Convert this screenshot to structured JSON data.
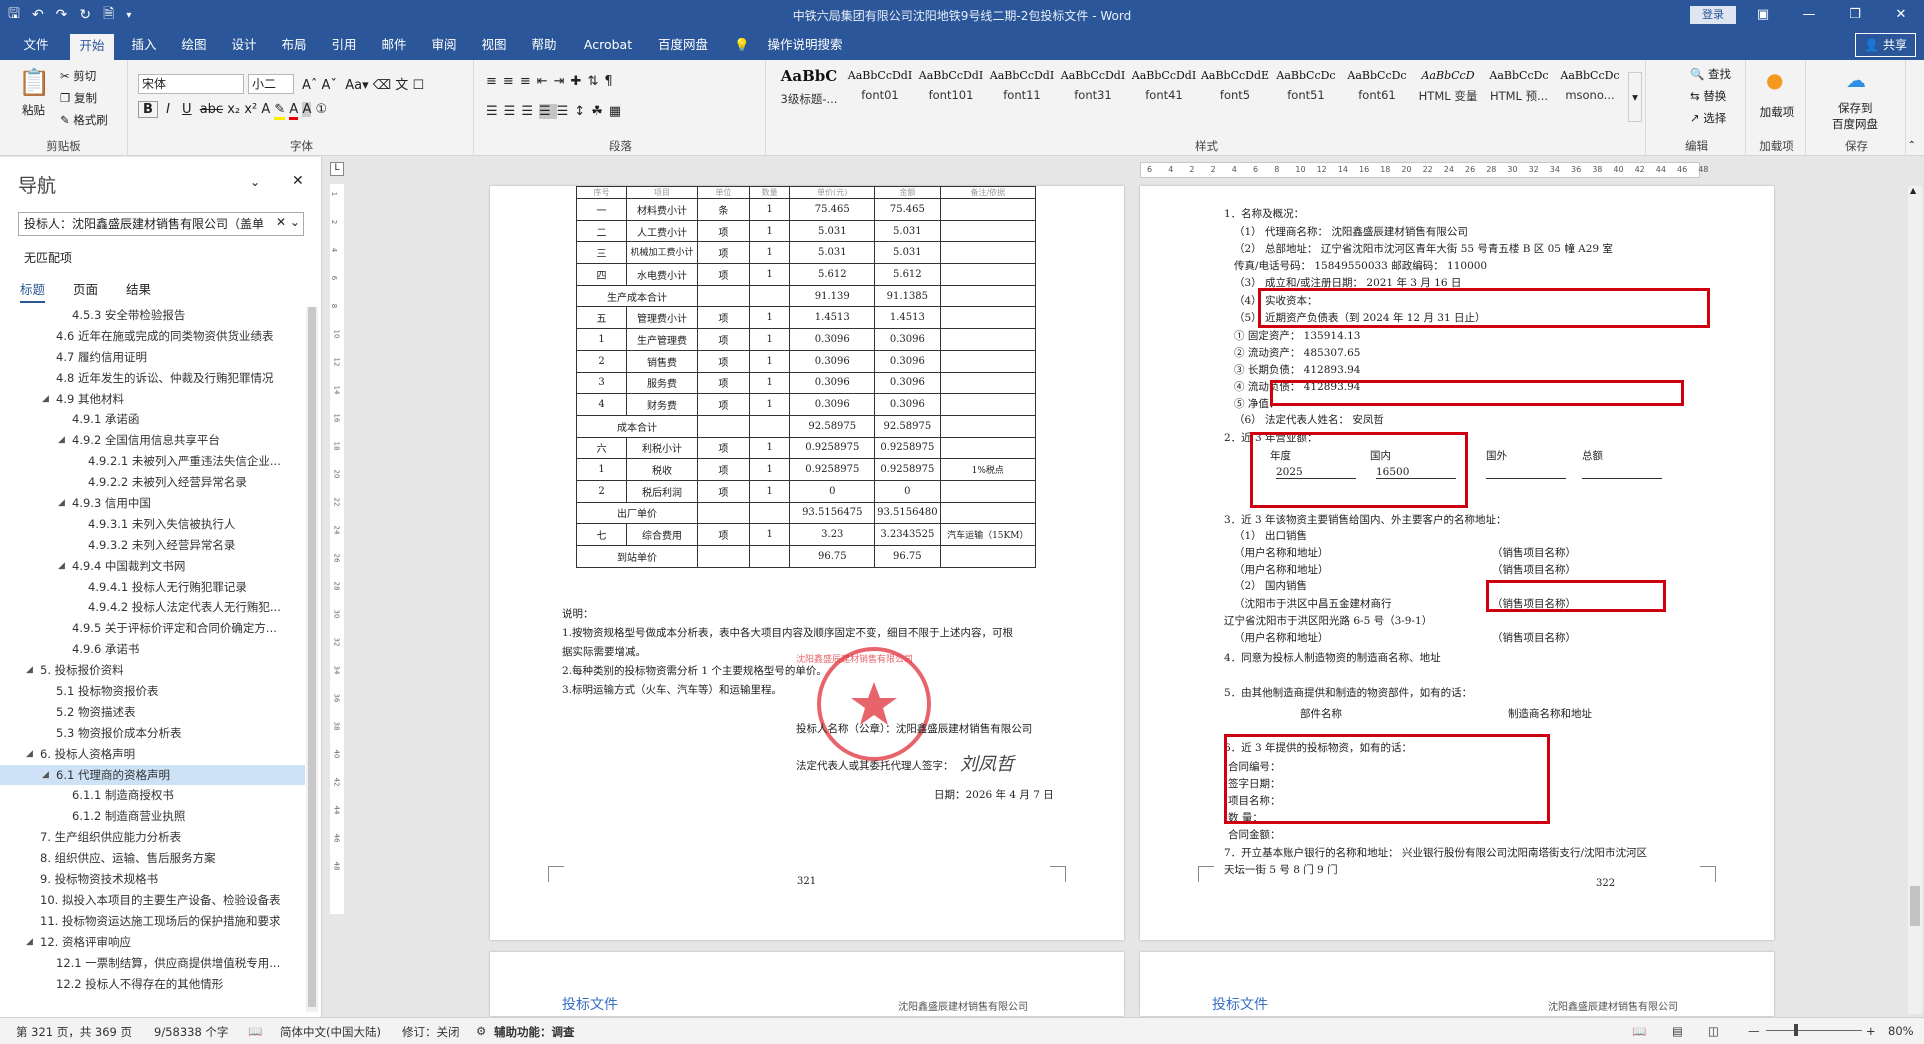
{
  "title_bar": {
    "document_title": "中铁六局集团有限公司沈阳地铁9号线二期-2包投标文件  -  Word",
    "login": "登录",
    "qat_icons": [
      "save-icon",
      "undo-icon",
      "redo-icon",
      "autosave-icon",
      "doc-icon",
      "customize-icon"
    ]
  },
  "tabs": [
    "文件",
    "开始",
    "插入",
    "绘图",
    "设计",
    "布局",
    "引用",
    "邮件",
    "审阅",
    "视图",
    "帮助",
    "Acrobat",
    "百度网盘",
    "操作说明搜索"
  ],
  "active_tab": "开始",
  "share": "共享",
  "ribbon": {
    "clipboard": {
      "paste": "粘贴",
      "cut": "剪切",
      "copy": "复制",
      "format_painter": "格式刷",
      "group": "剪贴板"
    },
    "font": {
      "name": "宋体",
      "size": "小二",
      "group": "字体"
    },
    "paragraph": {
      "group": "段落"
    },
    "styles": {
      "group": "样式",
      "items": [
        {
          "sample": "AaBbC",
          "name": "3级标题-..."
        },
        {
          "sample": "AaBbCcDdI",
          "name": "font01"
        },
        {
          "sample": "AaBbCcDdI",
          "name": "font101"
        },
        {
          "sample": "AaBbCcDdI",
          "name": "font11"
        },
        {
          "sample": "AaBbCcDdI",
          "name": "font31"
        },
        {
          "sample": "AaBbCcDdI",
          "name": "font41"
        },
        {
          "sample": "AaBbCcDdE",
          "name": "font5"
        },
        {
          "sample": "AaBbCcDc",
          "name": "font51"
        },
        {
          "sample": "AaBbCcDc",
          "name": "font61"
        },
        {
          "sample": "AaBbCcD",
          "name": "HTML 变量"
        },
        {
          "sample": "AaBbCcDc",
          "name": "HTML 预..."
        },
        {
          "sample": "AaBbCcDc",
          "name": "msono..."
        }
      ]
    },
    "editing": {
      "find": "查找",
      "replace": "替换",
      "select": "选择",
      "group": "编辑"
    },
    "addins": {
      "label": "加载项",
      "group": "加载项"
    },
    "save": {
      "label1": "保存到",
      "label2": "百度网盘",
      "group": "保存"
    }
  },
  "nav": {
    "title": "导航",
    "search": "投标人：沈阳鑫盛辰建材销售有限公司（盖单",
    "no_match": "无匹配项",
    "subtabs": [
      "标题",
      "页面",
      "结果"
    ],
    "items": [
      {
        "text": "4.5.3 安全带检验报告",
        "level": 4
      },
      {
        "text": "4.6 近年在施或完成的同类物资供货业绩表",
        "level": 3
      },
      {
        "text": "4.7 履约信用证明",
        "level": 3
      },
      {
        "text": "4.8 近年发生的诉讼、仲裁及行贿犯罪情况",
        "level": 3
      },
      {
        "text": "4.9 其他材料",
        "level": 3,
        "expand": true
      },
      {
        "text": "4.9.1 承诺函",
        "level": 4
      },
      {
        "text": "4.9.2 全国信用信息共享平台",
        "level": 4,
        "expand": true
      },
      {
        "text": "4.9.2.1 未被列入严重违法失信企业...",
        "level": 5
      },
      {
        "text": "4.9.2.2 未被列入经营异常名录",
        "level": 5
      },
      {
        "text": "4.9.3 信用中国",
        "level": 4,
        "expand": true
      },
      {
        "text": "4.9.3.1 未列入失信被执行人",
        "level": 5
      },
      {
        "text": "4.9.3.2 未列入经营异常名录",
        "level": 5
      },
      {
        "text": "4.9.4 中国裁判文书网",
        "level": 4,
        "expand": true
      },
      {
        "text": "4.9.4.1 投标人无行贿犯罪记录",
        "level": 5
      },
      {
        "text": "4.9.4.2 投标人法定代表人无行贿犯...",
        "level": 5
      },
      {
        "text": "4.9.5 关于评标价评定和合同价确定方...",
        "level": 4
      },
      {
        "text": "4.9.6 承诺书",
        "level": 4
      },
      {
        "text": "5. 投标报价资料",
        "level": 2,
        "expand": true
      },
      {
        "text": "5.1 投标物资报价表",
        "level": 3
      },
      {
        "text": "5.2 物资描述表",
        "level": 3
      },
      {
        "text": "5.3 物资报价成本分析表",
        "level": 3
      },
      {
        "text": "6. 投标人资格声明",
        "level": 2,
        "expand": true
      },
      {
        "text": "6.1 代理商的资格声明",
        "level": 3,
        "expand": true,
        "selected": true
      },
      {
        "text": "6.1.1 制造商授权书",
        "level": 4
      },
      {
        "text": "6.1.2 制造商营业执照",
        "level": 4
      },
      {
        "text": "7. 生产组织供应能力分析表",
        "level": 2
      },
      {
        "text": "8. 组织供应、运输、售后服务方案",
        "level": 2
      },
      {
        "text": "9. 投标物资技术规格书",
        "level": 2
      },
      {
        "text": "10. 拟投入本项目的主要生产设备、检验设备表",
        "level": 2
      },
      {
        "text": "11. 投标物资运达施工现场后的保护措施和要求",
        "level": 2
      },
      {
        "text": "12. 资格评审响应",
        "level": 2,
        "expand": true
      },
      {
        "text": "12.1 一票制结算，供应商提供增值税专用...",
        "level": 3
      },
      {
        "text": "12.2 投标人不得存在的其他情形",
        "level": 3
      }
    ]
  },
  "ruler": {
    "left_ticks": [
      "1",
      "2",
      "4",
      "6",
      "8",
      "10",
      "12",
      "14",
      "16",
      "18",
      "20",
      "22",
      "24",
      "26",
      "28",
      "30",
      "32",
      "34",
      "36",
      "38",
      "40",
      "42",
      "44",
      "46",
      "48"
    ],
    "top_ticks": [
      "6",
      "4",
      "2",
      "2",
      "4",
      "6",
      "8",
      "10",
      "12",
      "14",
      "16",
      "18",
      "20",
      "22",
      "24",
      "26",
      "28",
      "30",
      "32",
      "34",
      "36",
      "38",
      "40",
      "42",
      "44",
      "46",
      "48"
    ]
  },
  "page_left": {
    "table_header": [
      "序号",
      "项目",
      "单位",
      "数量",
      "单价(元)",
      "金额",
      "备注/依据"
    ],
    "rows": [
      [
        "一",
        "材料费小计",
        "条",
        "1",
        "75.465",
        "75.465",
        ""
      ],
      [
        "二",
        "人工费小计",
        "项",
        "1",
        "5.031",
        "5.031",
        ""
      ],
      [
        "三",
        "机械加工费小计",
        "项",
        "1",
        "5.031",
        "5.031",
        ""
      ],
      [
        "四",
        "水电费小计",
        "项",
        "1",
        "5.612",
        "5.612",
        ""
      ],
      [
        "",
        "生产成本合计",
        "",
        "",
        "91.139",
        "91.1385",
        ""
      ],
      [
        "五",
        "管理费小计",
        "项",
        "1",
        "1.4513",
        "1.4513",
        ""
      ],
      [
        "1",
        "生产管理费",
        "项",
        "1",
        "0.3096",
        "0.3096",
        ""
      ],
      [
        "2",
        "销售费",
        "项",
        "1",
        "0.3096",
        "0.3096",
        ""
      ],
      [
        "3",
        "服务费",
        "项",
        "1",
        "0.3096",
        "0.3096",
        ""
      ],
      [
        "4",
        "财务费",
        "项",
        "1",
        "0.3096",
        "0.3096",
        ""
      ],
      [
        "",
        "成本合计",
        "",
        "",
        "92.58975",
        "92.58975",
        ""
      ],
      [
        "六",
        "利税小计",
        "项",
        "1",
        "0.9258975",
        "0.9258975",
        ""
      ],
      [
        "1",
        "税收",
        "项",
        "1",
        "0.9258975",
        "0.9258975",
        "1%税点"
      ],
      [
        "2",
        "税后利润",
        "项",
        "1",
        "0",
        "0",
        ""
      ],
      [
        "",
        "出厂单价",
        "",
        "",
        "93.5156475",
        "93.5156480",
        ""
      ],
      [
        "七",
        "综合费用",
        "项",
        "1",
        "3.23",
        "3.2343525",
        "汽车运输（15KM）"
      ],
      [
        "",
        "到站单价",
        "",
        "",
        "96.75",
        "96.75",
        ""
      ]
    ],
    "notes_title": "说明：",
    "notes": [
      "1.按物资规格型号做成本分析表，表中各大项目内容及顺序固定不变，细目不限于上述内容，可根",
      "据实际需要增减。",
      "2.每种类别的投标物资需分析 1 个主要规格型号的单价。",
      "3.标明运输方式（火车、汽车等）和运输里程。"
    ],
    "bidder": "投标人名称（公章）：沈阳鑫盛辰建材销售有限公司",
    "legal_rep": "法定代表人或其委托代理人签字：",
    "signature": "刘凤哲",
    "date": "日期：2026 年 4 月 7 日",
    "page_no": "321",
    "seal_text": "沈阳鑫盛辰建材销售有限公司"
  },
  "page_right": {
    "lines": [
      "1．名称及概况：",
      "（1）  代理商名称：   沈阳鑫盛辰建材销售有限公司",
      "（2）  总部地址：    辽宁省沈阳市沈河区青年大街 55 号青五楼 B 区 05 幢 A29 室",
      "        传真/电话号码：   15849550033     邮政编码：   110000",
      "（3）  成立和/或注册日期：   2021 年 3 月 16 日",
      "（4）  实收资本：",
      "（5）  近期资产负债表（到  2024  年   12  月  31  日止）",
      "        ①    固定资产：    135914.13",
      "        ②    流动资产：    485307.65",
      "        ③    长期负债：    412893.94",
      "        ④    流动负债：    412893.94",
      "        ⑤    净值：",
      "（6）  法定代表人姓名：    安凤哲",
      "2．近 3 年营业额：",
      "3．近 3 年该物资主要销售给国内、外主要客户的名称地址：",
      "（1）   出口销售",
      "（用户名称和地址）",
      "（用户名称和地址）",
      "（2）   国内销售",
      "（沈阳市于洪区中昌五金建材商行",
      "辽宁省沈阳市于洪区阳光路 6-5 号（3-9-1）",
      "（用户名称和地址）",
      "4．同意为投标人制造物资的制造商名称、地址",
      "5．由其他制造商提供和制造的物资部件，如有的话：",
      "部件名称",
      "制造商名称和地址",
      "6．近 3 年提供的投标物资，如有的话：",
      "合同编号：",
      "签字日期：",
      "项目名称：",
      "数    量：",
      "合同金额：",
      "7．开立基本账户银行的名称和地址：   兴业银行股份有限公司沈阳南塔街支行/沈阳市沈河区",
      "天坛一街 5 号 8 门 9 门"
    ],
    "turnover_headers": [
      "年度",
      "国内",
      "国外",
      "总额"
    ],
    "turnover_row": [
      "2025",
      "16500",
      "",
      ""
    ],
    "sales_product": "（销售项目名称）",
    "page_no": "322"
  },
  "page_footer": {
    "left": "投标文件",
    "right": "沈阳鑫盛辰建材销售有限公司"
  },
  "status": {
    "page": "第 321 页，共 369 页",
    "words": "9/58338 个字",
    "lang": "简体中文(中国大陆)",
    "track": "修订：关闭",
    "access": "辅助功能：调查",
    "zoom": "80%"
  },
  "colors": {
    "brand": "#2b579a",
    "highlight_box": "#cc0010",
    "seal": "#e0303a"
  }
}
